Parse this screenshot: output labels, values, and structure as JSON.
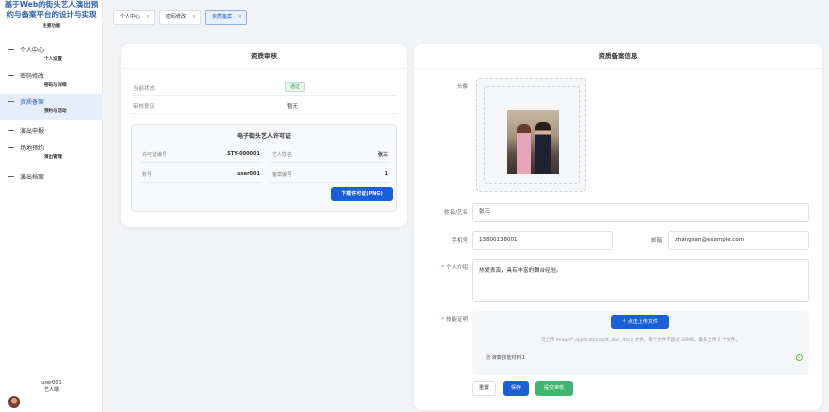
{
  "sidebar": {
    "title": "基于Web的街头艺人演出预约与备案平台的设计与实现",
    "subtitle": "主要功能",
    "items": [
      {
        "label": "个人中心",
        "sub": "个人设置"
      },
      {
        "label": "密码修改",
        "sub": "密码与详细"
      },
      {
        "label": "资质备案",
        "sub": "预约与活动"
      },
      {
        "label": "演出申报",
        "sub": ""
      },
      {
        "label": "场地预约",
        "sub": "演出管理"
      },
      {
        "label": "演出档案",
        "sub": ""
      }
    ],
    "user": {
      "name": "user001",
      "role": "艺人端"
    }
  },
  "tabs": [
    {
      "label": "个人中心"
    },
    {
      "label": "密码修改"
    },
    {
      "label": "资质备案"
    }
  ],
  "review": {
    "title": "资质审核",
    "status_label": "当前状态",
    "status_value": "通过",
    "opinion_label": "审核意见",
    "opinion_value": "暂无",
    "license": {
      "title": "电子街头艺人许可证",
      "license_no_label": "许可证编号",
      "license_no": "STY-000001",
      "artist_name_label": "艺人姓名",
      "artist_name": "张三",
      "account_label": "账号",
      "account": "user001",
      "record_no_label": "备案编号",
      "record_no": "1",
      "download_label": "下载许可证(PNG)"
    }
  },
  "form": {
    "title": "资质备案信息",
    "avatar_label": "头像",
    "name_label": "姓名/艺名",
    "name_value": "张三",
    "phone_label": "手机号",
    "phone_value": "13800138001",
    "email_label": "邮箱",
    "email_value": "zhangsan@example.com",
    "intro_label": "个人介绍",
    "intro_value": "热爱表演，具有丰富的舞台经验。",
    "skill_label": "技能证明",
    "upload_label": "点击上传文件",
    "upload_hint": "可上传 image/*,application/pdf,.doc,.docx 文件，每个文件不超过 20MB，最多上传 5 个文件。",
    "file_name": "演奏技能材料1",
    "reset_label": "重置",
    "save_label": "保存",
    "submit_label": "提交审核"
  }
}
